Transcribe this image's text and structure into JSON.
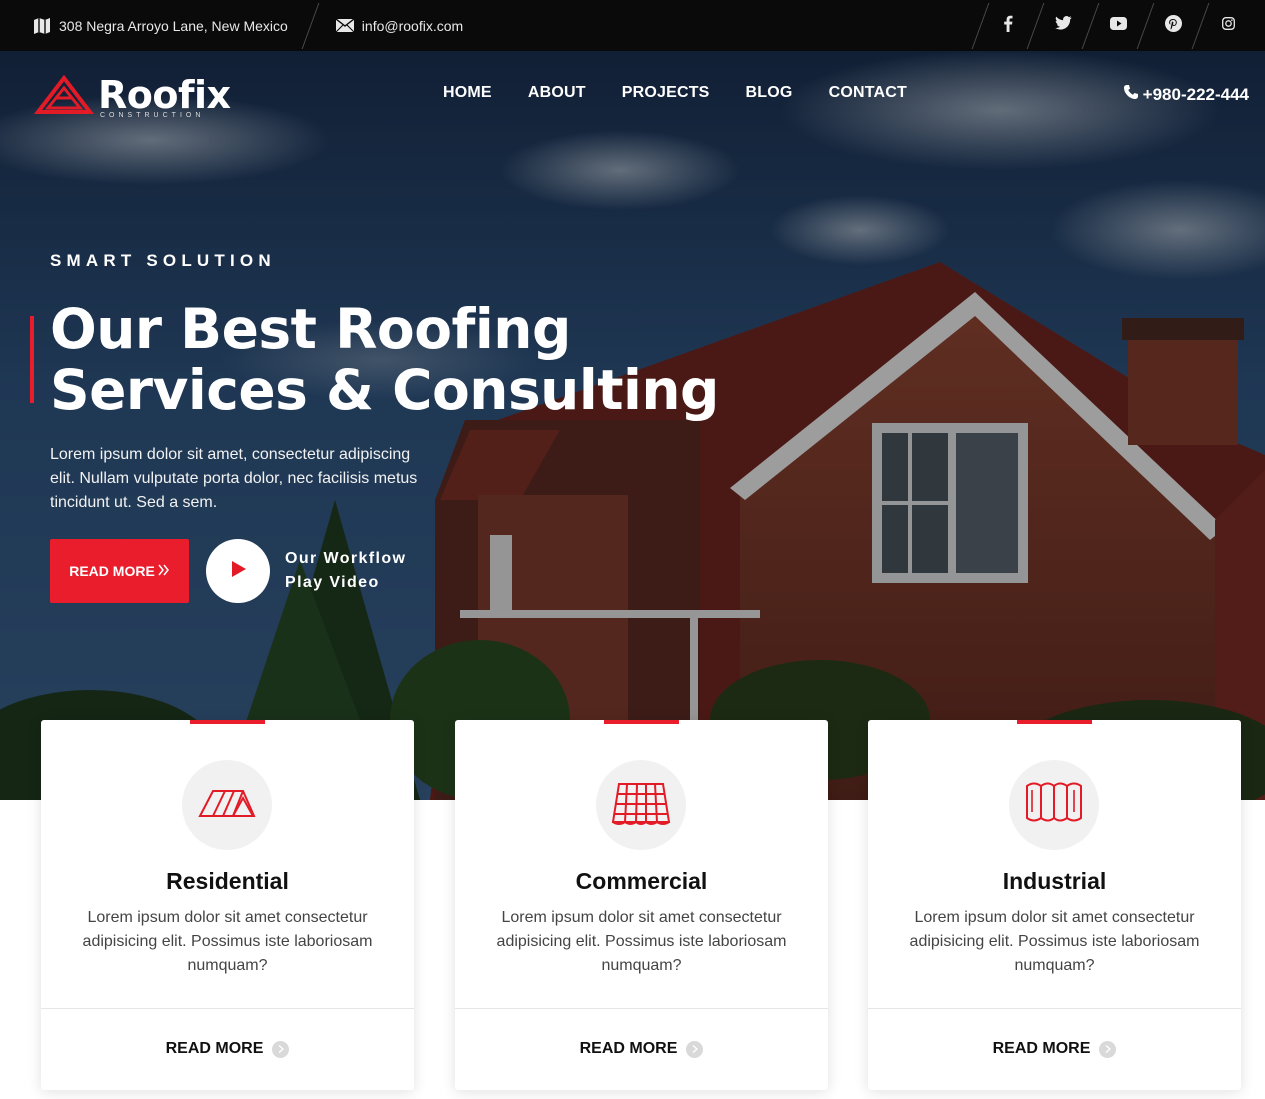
{
  "topbar": {
    "address": "308 Negra Arroyo Lane, New Mexico",
    "email": "info@roofix.com",
    "socials": [
      "facebook-icon",
      "twitter-icon",
      "youtube-icon",
      "pinterest-icon",
      "instagram-icon"
    ]
  },
  "header": {
    "logo_name": "Roofix",
    "logo_sub": "CONSTRUCTION",
    "nav": [
      "HOME",
      "ABOUT",
      "PROJECTS",
      "BLOG",
      "CONTACT"
    ],
    "phone": "+980-222-444"
  },
  "hero": {
    "eyebrow": "SMART SOLUTION",
    "headline_line1": "Our Best Roofing",
    "headline_line2": "Services & Consulting",
    "paragraph": "Lorem ipsum dolor sit amet, consectetur adipiscing elit. Nullam vulputate porta dolor, nec facilisis metus tincidunt ut. Sed a sem.",
    "cta_label": "READ MORE",
    "video_line1": "Our Workflow",
    "video_line2": "Play Video"
  },
  "cards": [
    {
      "title": "Residential",
      "text": "Lorem ipsum dolor sit amet consectetur adipisicing elit. Possimus iste laboriosam numquam?",
      "link": "READ MORE",
      "icon": "residential-roof-icon"
    },
    {
      "title": "Commercial",
      "text": "Lorem ipsum dolor sit amet consectetur adipisicing elit. Possimus iste laboriosam numquam?",
      "link": "READ MORE",
      "icon": "roof-tiles-icon"
    },
    {
      "title": "Industrial",
      "text": "Lorem ipsum dolor sit amet consectetur adipisicing elit. Possimus iste laboriosam numquam?",
      "link": "READ MORE",
      "icon": "industrial-sheet-icon"
    }
  ],
  "colors": {
    "accent": "#ea1d2c",
    "topbar": "#0a0a0a",
    "sky": "#2c4f7a",
    "brick": "#8a3b2e",
    "roof": "#6e2620"
  }
}
